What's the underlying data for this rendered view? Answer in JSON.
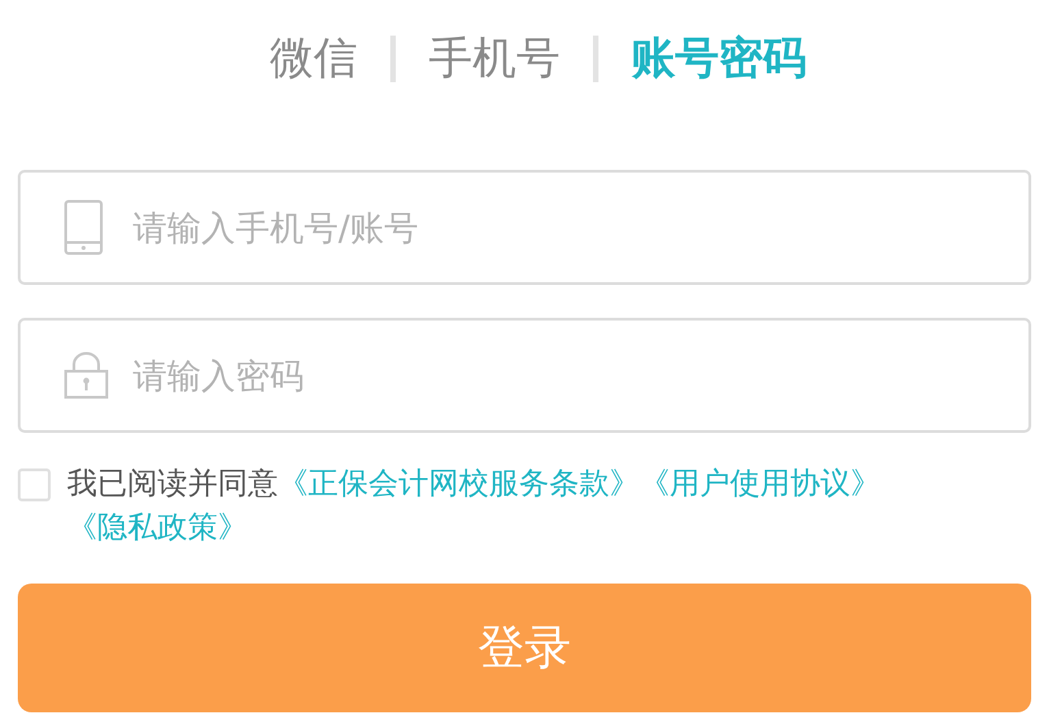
{
  "tabs": [
    {
      "label": "微信",
      "selected": false
    },
    {
      "label": "手机号",
      "selected": false
    },
    {
      "label": "账号密码",
      "selected": true
    }
  ],
  "fields": [
    {
      "kind": "phone",
      "placeholder": "请输入手机号/账号"
    },
    {
      "kind": "lock",
      "placeholder": "请输入密码"
    }
  ],
  "agreement": {
    "checked": false,
    "text": "我已阅读并同意",
    "links": [
      "《正保会计网校服务条款》",
      "《用户使用协议》",
      "《隐私政策》"
    ]
  },
  "submit": {
    "label": "登录"
  }
}
